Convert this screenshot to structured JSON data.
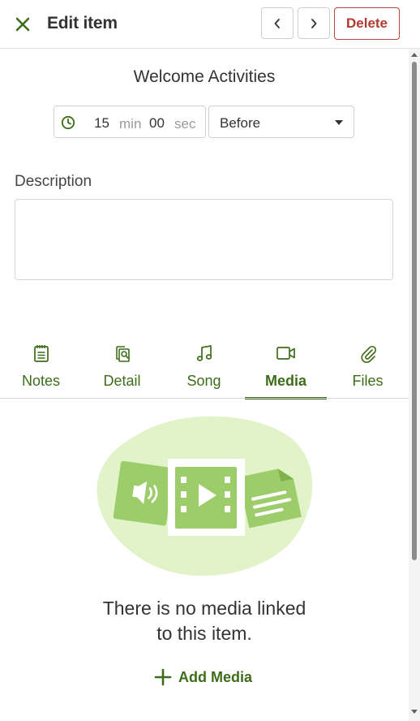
{
  "header": {
    "title": "Edit item",
    "delete_label": "Delete",
    "close_icon": "close-icon",
    "prev_icon": "chevron-left-icon",
    "next_icon": "chevron-right-icon"
  },
  "item": {
    "name": "Welcome Activities",
    "duration": {
      "minutes": "15",
      "minutes_unit": "min",
      "seconds": "00",
      "seconds_unit": "sec"
    },
    "timing": "Before"
  },
  "description": {
    "label": "Description",
    "value": ""
  },
  "tabs": [
    {
      "label": "Notes",
      "icon": "notes-icon",
      "active": false
    },
    {
      "label": "Detail",
      "icon": "detail-icon",
      "active": false
    },
    {
      "label": "Song",
      "icon": "music-note-icon",
      "active": false
    },
    {
      "label": "Media",
      "icon": "video-camera-icon",
      "active": true
    },
    {
      "label": "Files",
      "icon": "paperclip-icon",
      "active": false
    }
  ],
  "media": {
    "empty_line_1": "There is no media linked",
    "empty_line_2": "to this item.",
    "add_label": "Add Media"
  },
  "colors": {
    "accent": "#3d6d1a",
    "delete": "#b03a2e",
    "illustration_light": "#e2f3ca",
    "illustration_mid": "#9dcd6a"
  }
}
